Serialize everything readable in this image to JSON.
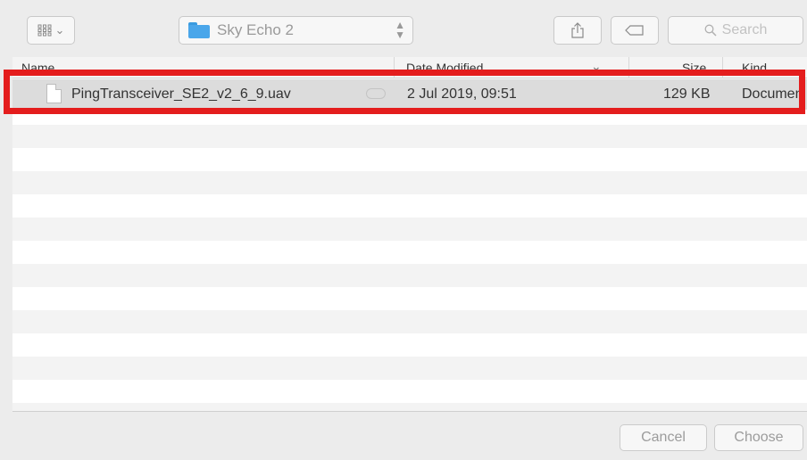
{
  "toolbar": {
    "view_icon": "grid-view-icon",
    "view_chevron": "⌄",
    "location": "Sky Echo 2",
    "location_icon": "folder-icon",
    "share_icon": "share-icon",
    "tag_icon": "tag-icon",
    "search_placeholder": "Search",
    "search_icon": "magnifier-icon"
  },
  "columns": {
    "name": "Name",
    "date": "Date Modified",
    "sort_indicator": "⌄",
    "size": "Size",
    "kind": "Kind"
  },
  "files": [
    {
      "name": "PingTransceiver_SE2_v2_6_9.uav",
      "date": "2 Jul 2019, 09:51",
      "size": "129 KB",
      "kind": "Documen",
      "icon": "document-icon",
      "status_icon": "cloud-icon",
      "selected": true
    }
  ],
  "footer": {
    "cancel": "Cancel",
    "choose": "Choose"
  },
  "colors": {
    "highlight": "#e41d1d",
    "folder": "#4aa6ea",
    "selected_row": "#dcdcdc"
  }
}
